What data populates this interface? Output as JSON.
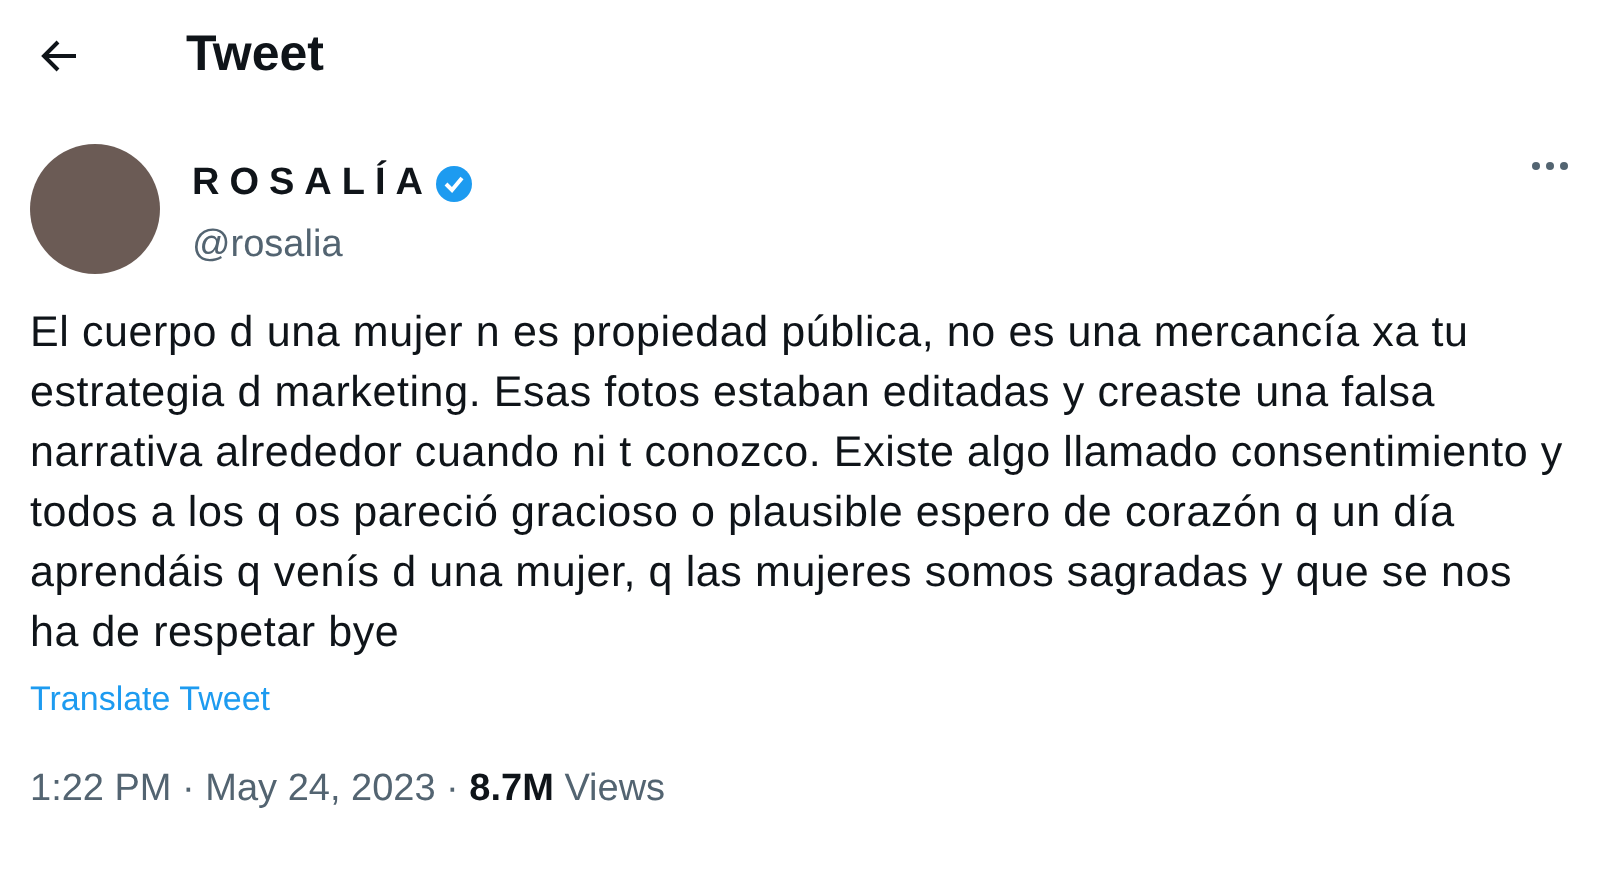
{
  "header": {
    "title": "Tweet"
  },
  "author": {
    "name": "ROSALÍA",
    "verified": true,
    "handle": "@rosalia"
  },
  "tweet": {
    "text": "El cuerpo d una mujer n es propiedad pública, no es una mercancía xa tu estrategia d marketing. Esas fotos estaban editadas y creaste una falsa narrativa alrededor cuando ni t conozco. Existe algo llamado consentimiento y todos a los q os pareció gracioso o plausible espero de corazón q un día aprendáis q venís d una mujer, q las mujeres somos sagradas y que se nos ha de respetar bye",
    "translate": "Translate Tweet",
    "meta": "1:22 PM · May 24, 2023 · **8.7M** Views"
  }
}
